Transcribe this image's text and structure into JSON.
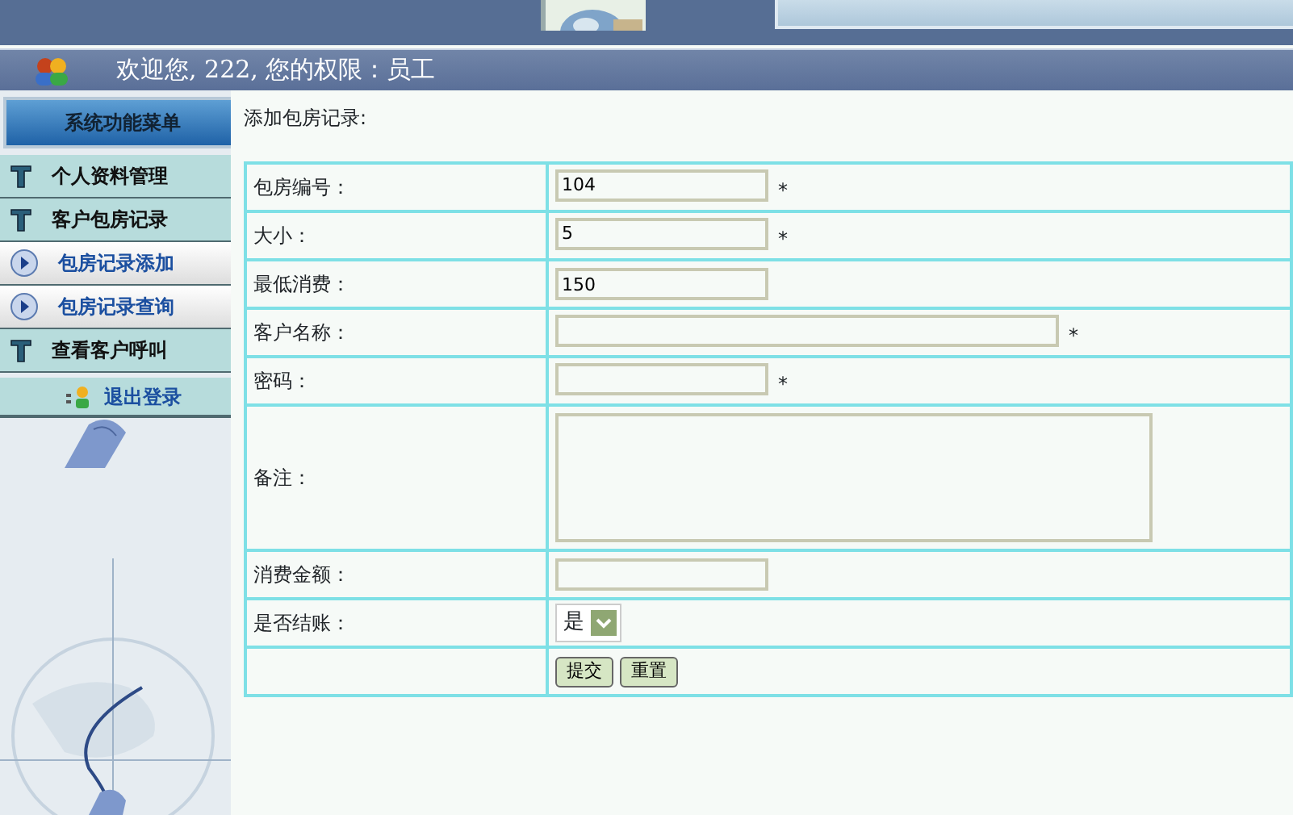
{
  "header": {
    "welcome": "欢迎您, 222, 您的权限：员工"
  },
  "sidebar": {
    "title": "系统功能菜单",
    "items": [
      {
        "label": "个人资料管理",
        "kind": "group"
      },
      {
        "label": "客户包房记录",
        "kind": "group"
      },
      {
        "label": "包房记录添加",
        "kind": "link"
      },
      {
        "label": "包房记录查询",
        "kind": "link"
      },
      {
        "label": "查看客户呼叫",
        "kind": "group"
      }
    ],
    "logout": "退出登录"
  },
  "form": {
    "title": "添加包房记录:",
    "fields": [
      {
        "label": "包房编号：",
        "kind": "text",
        "value": "104",
        "mark": "*"
      },
      {
        "label": "大小：",
        "kind": "text",
        "value": "5",
        "mark": "*"
      },
      {
        "label": "最低消费：",
        "kind": "text",
        "value": "150"
      },
      {
        "label": "客户名称：",
        "kind": "widetext",
        "mark": "*"
      },
      {
        "label": "密码：",
        "kind": "password",
        "mark": "*"
      },
      {
        "label": "备注：",
        "kind": "textarea"
      },
      {
        "label": "消费金额：",
        "kind": "text"
      },
      {
        "label": "是否结账：",
        "kind": "select",
        "value": "是"
      }
    ],
    "buttons": [
      "提交",
      "重置"
    ]
  }
}
